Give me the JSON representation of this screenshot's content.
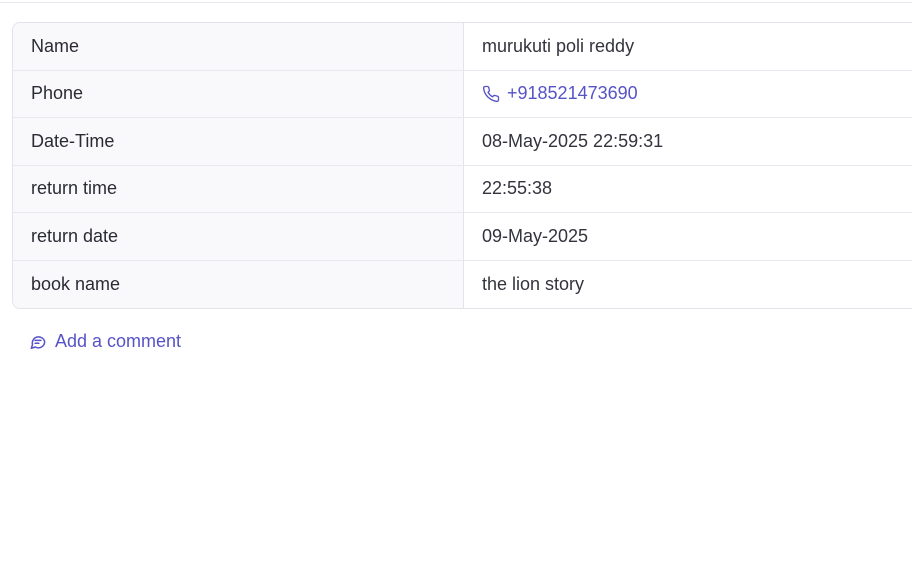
{
  "details": {
    "rows": [
      {
        "label": "Name",
        "value": "murukuti poli reddy"
      },
      {
        "label": "Phone",
        "value": "+918521473690"
      },
      {
        "label": "Date-Time",
        "value": "08-May-2025 22:59:31"
      },
      {
        "label": "return time",
        "value": "22:55:38"
      },
      {
        "label": "return date",
        "value": "09-May-2025"
      },
      {
        "label": "book name",
        "value": "the lion story"
      }
    ]
  },
  "comment": {
    "label": "Add a comment",
    "icon": "chat-bubbles-icon"
  },
  "icons": {
    "phone": "phone-icon"
  },
  "colors": {
    "accent": "#5653c7",
    "label_bg": "#f9f9fc",
    "border": "#e3e3ea"
  }
}
